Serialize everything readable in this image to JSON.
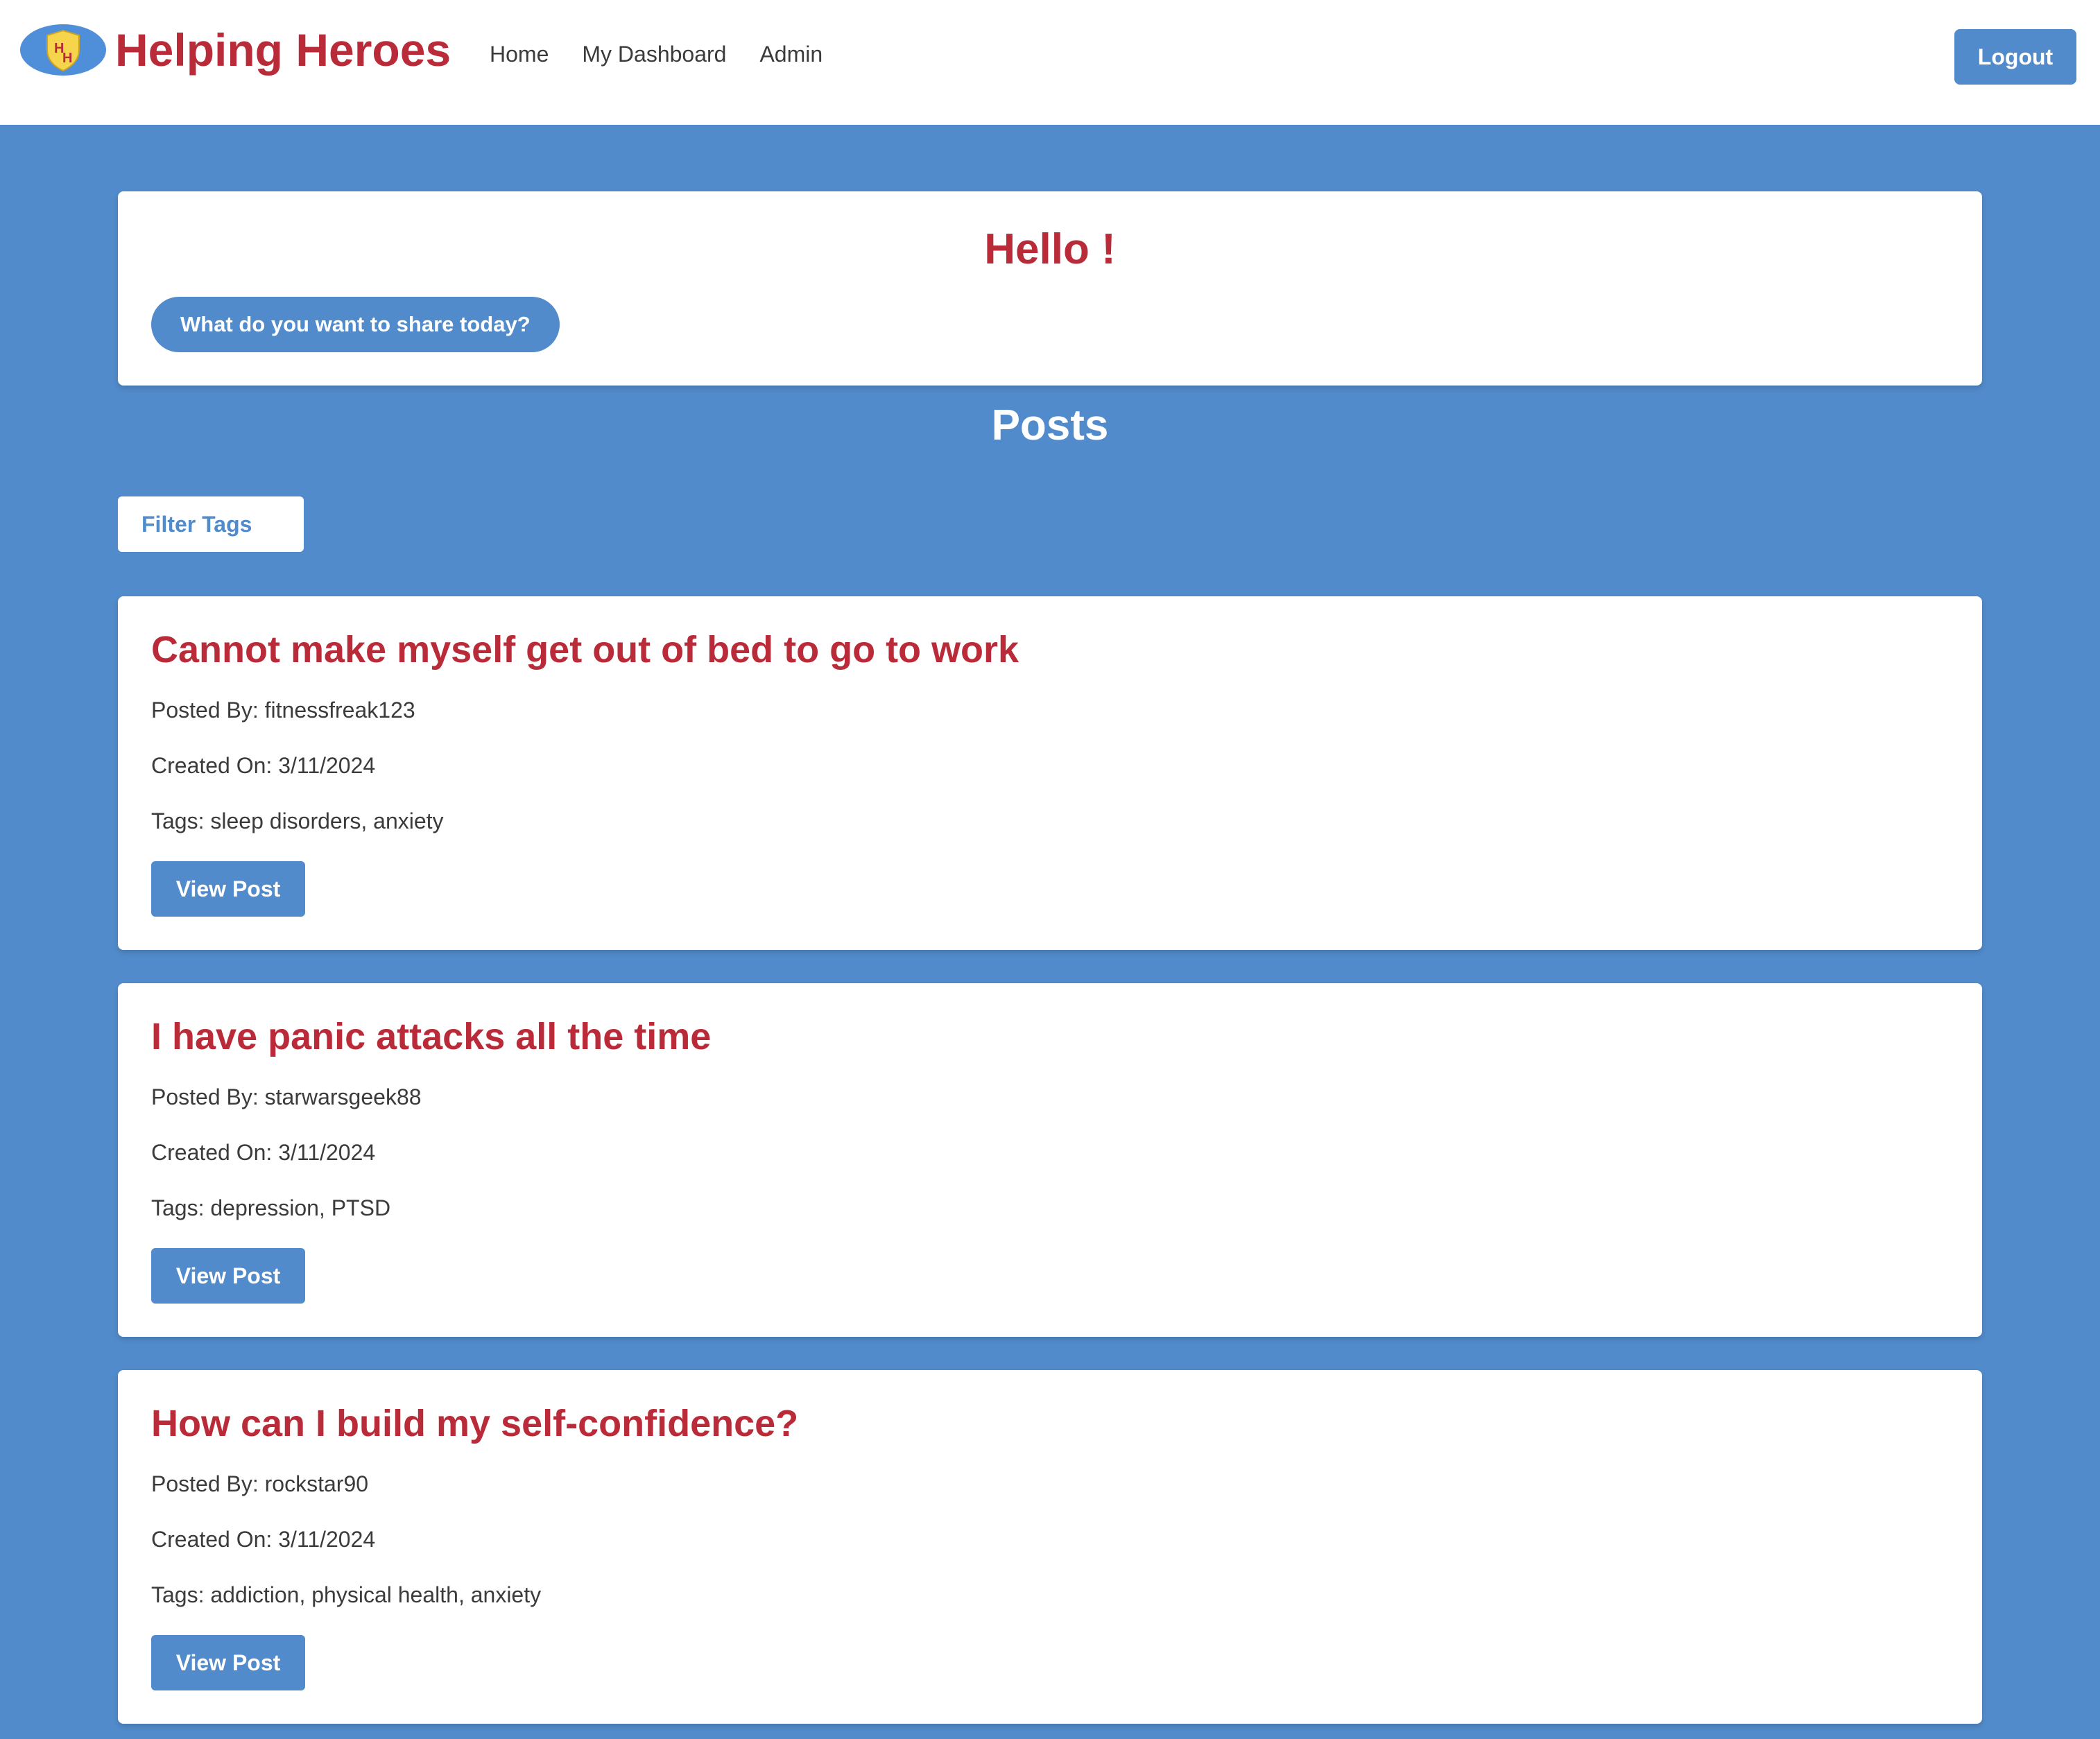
{
  "app": {
    "brand_name": "Helping Heroes",
    "logo_letters": [
      "H",
      "H"
    ]
  },
  "nav": {
    "items": [
      {
        "label": "Home"
      },
      {
        "label": "My Dashboard"
      },
      {
        "label": "Admin"
      }
    ],
    "logout_label": "Logout"
  },
  "greeting": {
    "title": "Hello !",
    "share_button_label": "What do you want to share today?"
  },
  "posts_section": {
    "heading": "Posts",
    "filter_button_label": "Filter Tags"
  },
  "posts": [
    {
      "title": "Cannot make myself get out of bed to go to work",
      "posted_by": "Posted By: fitnessfreak123",
      "created_on": "Created On: 3/11/2024",
      "tags": "Tags: sleep disorders, anxiety",
      "button_label": "View Post"
    },
    {
      "title": "I have panic attacks all the time",
      "posted_by": "Posted By: starwarsgeek88",
      "created_on": "Created On: 3/11/2024",
      "tags": "Tags: depression, PTSD",
      "button_label": "View Post"
    },
    {
      "title": "How can I build my self-confidence?",
      "posted_by": "Posted By: rockstar90",
      "created_on": "Created On: 3/11/2024",
      "tags": "Tags: addiction, physical health, anxiety",
      "button_label": "View Post"
    }
  ],
  "colors": {
    "page_background": "#528bcb",
    "brand_red": "#b92b39",
    "button_blue": "#528bcb",
    "card_background": "#ffffff",
    "text": "#3b3b3b"
  },
  "icons": {
    "logo": "shield-icon"
  }
}
